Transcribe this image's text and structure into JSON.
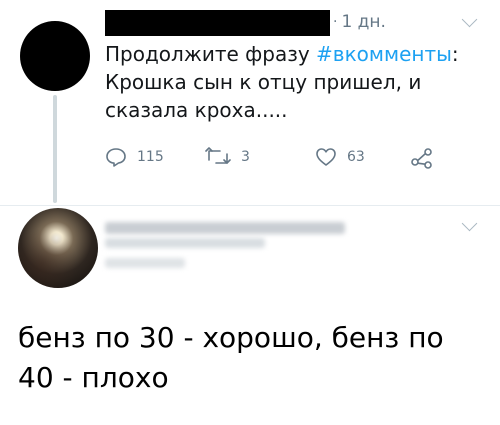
{
  "tweet": {
    "time_ago": "1 дн.",
    "text_intro": "Продолжите фразу ",
    "hashtag": "#вкомменты",
    "text_colon": ":",
    "text_rest": "Крошка сын к отцу пришел, и сказала кроха.....",
    "counts": {
      "replies": "115",
      "retweets": "3",
      "likes": "63"
    },
    "colors": {
      "hashtag": "#1da1f2",
      "meta": "#657786"
    }
  },
  "reply": {
    "text": "бенз по 30 - хорошо, бенз по 40 - плохо"
  },
  "icons": {
    "reply": "reply-icon",
    "retweet": "retweet-icon",
    "like": "heart-icon",
    "share": "share-icon",
    "menu": "chevron-down-icon"
  }
}
